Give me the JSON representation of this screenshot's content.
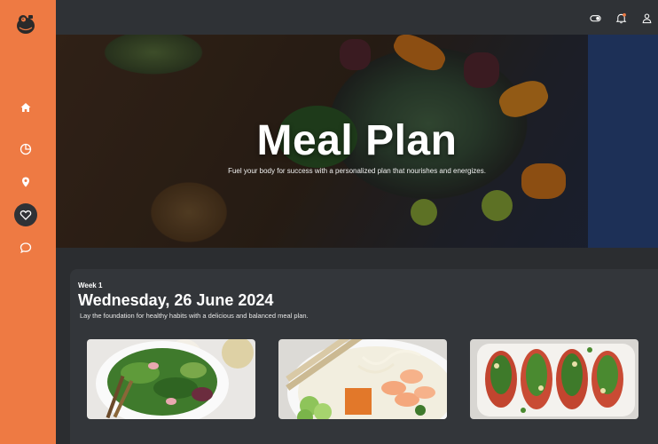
{
  "app": {
    "logo_icon": "gorilla-logo-icon",
    "accent": "#ee7a43",
    "dark": "#2f3236"
  },
  "sidebar": {
    "items": [
      {
        "name": "home",
        "icon": "home-icon",
        "active": false
      },
      {
        "name": "stats",
        "icon": "pie-chart-icon",
        "active": false
      },
      {
        "name": "location",
        "icon": "map-pin-icon",
        "active": false
      },
      {
        "name": "favorites",
        "icon": "heart-icon",
        "active": true
      },
      {
        "name": "messages",
        "icon": "chat-bubble-icon",
        "active": false
      }
    ]
  },
  "topbar": {
    "icons": [
      "toggle-icon",
      "bell-icon",
      "user-icon"
    ]
  },
  "hero": {
    "title": "Meal Plan",
    "subtitle": "Fuel your body for success with a personalized plan that nourishes and energizes."
  },
  "day": {
    "week": "Week 1",
    "date": "Wednesday, 26 June 2024",
    "description": "Lay the foundation for healthy habits with a delicious and balanced meal plan."
  },
  "meals": [
    {
      "image": "green-salad"
    },
    {
      "image": "shrimp-noodle-bowl"
    },
    {
      "image": "stuffed-salmon-platter"
    }
  ]
}
